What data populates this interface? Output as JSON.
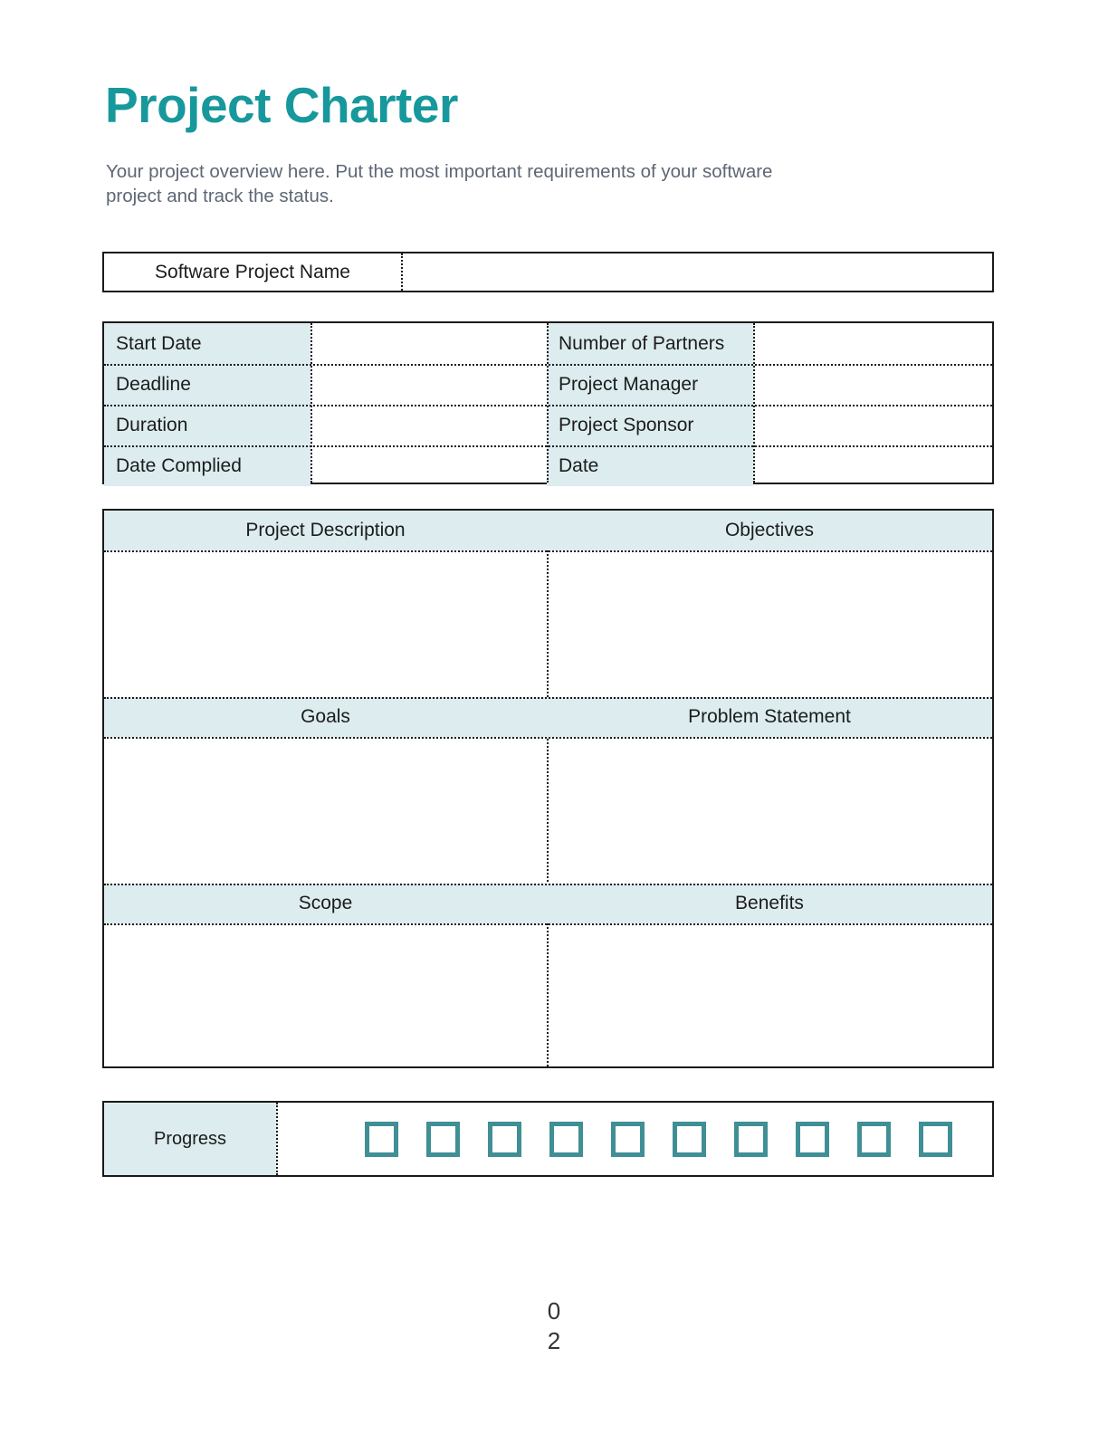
{
  "document": {
    "title": "Project Charter",
    "subtitle": "Your project overview here. Put the most important requirements of your software project and track the status.",
    "page_number_digits": [
      "0",
      "2"
    ]
  },
  "colors": {
    "accent_teal": "#17989c",
    "checkbox_teal": "#3f8f95",
    "cell_fill": "#dcecef",
    "text": "#1c1c1c",
    "subtitle_text": "#5d6775",
    "border": "#1a1a1a"
  },
  "name_row": {
    "label": "Software Project Name",
    "value": ""
  },
  "details": {
    "left": [
      {
        "label": "Start Date",
        "value": ""
      },
      {
        "label": "Deadline",
        "value": ""
      },
      {
        "label": "Duration",
        "value": ""
      },
      {
        "label": "Date Complied",
        "value": ""
      }
    ],
    "right": [
      {
        "label": "Number of Partners",
        "value": ""
      },
      {
        "label": "Project Manager",
        "value": ""
      },
      {
        "label": "Project Sponsor",
        "value": ""
      },
      {
        "label": "Date",
        "value": ""
      }
    ]
  },
  "content_sections": [
    {
      "left": {
        "header": "Project Description",
        "value": ""
      },
      "right": {
        "header": "Objectives",
        "value": ""
      }
    },
    {
      "left": {
        "header": "Goals",
        "value": ""
      },
      "right": {
        "header": "Problem Statement",
        "value": ""
      }
    },
    {
      "left": {
        "header": "Scope",
        "value": ""
      },
      "right": {
        "header": "Benefits",
        "value": ""
      }
    }
  ],
  "progress": {
    "label": "Progress",
    "checkbox_count": 10,
    "checked": [
      false,
      false,
      false,
      false,
      false,
      false,
      false,
      false,
      false,
      false
    ]
  }
}
